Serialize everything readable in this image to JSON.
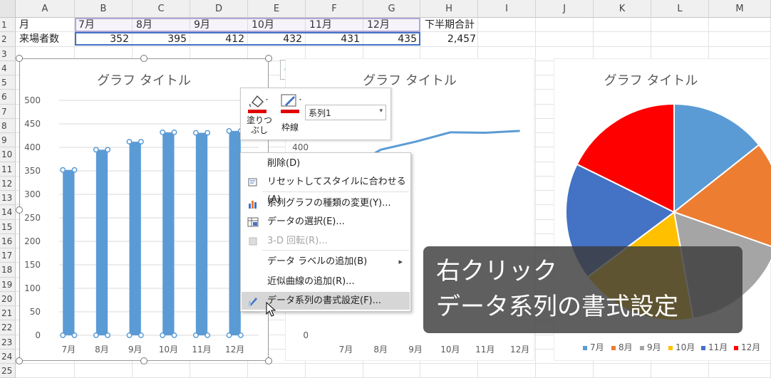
{
  "columns": [
    "A",
    "B",
    "C",
    "D",
    "E",
    "F",
    "G",
    "H",
    "I",
    "J",
    "K",
    "L",
    "M"
  ],
  "rows": [
    "1",
    "2",
    "3",
    "4",
    "5",
    "6",
    "7",
    "8",
    "9",
    "10",
    "11",
    "12",
    "13",
    "14",
    "15",
    "16",
    "17",
    "18",
    "19",
    "20",
    "21",
    "22",
    "23",
    "24",
    "25"
  ],
  "table": {
    "row1": {
      "a": "月",
      "months": [
        "7月",
        "8月",
        "9月",
        "10月",
        "11月",
        "12月"
      ],
      "h": "下半期合計"
    },
    "row2": {
      "a": "来場者数",
      "values": [
        "352",
        "395",
        "412",
        "432",
        "431",
        "435"
      ],
      "h": "2,457"
    }
  },
  "chart_data": [
    {
      "type": "bar",
      "title": "グラフ タイトル",
      "categories": [
        "7月",
        "8月",
        "9月",
        "10月",
        "11月",
        "12月"
      ],
      "values": [
        352,
        395,
        412,
        432,
        431,
        435
      ],
      "ylim": [
        0,
        500
      ],
      "yticks": [
        "0",
        "50",
        "100",
        "150",
        "200",
        "250",
        "300",
        "350",
        "400",
        "450",
        "500"
      ],
      "color": "#5b9bd5"
    },
    {
      "type": "line",
      "title": "グラフ タイトル",
      "categories": [
        "7月",
        "8月",
        "9月",
        "10月",
        "11月",
        "12月"
      ],
      "values": [
        352,
        395,
        412,
        432,
        431,
        435
      ],
      "ylim": [
        0,
        500
      ],
      "yticks": [
        "0",
        "400"
      ],
      "color": "#5b9bd5"
    },
    {
      "type": "pie",
      "title": "グラフ タイトル",
      "categories": [
        "7月",
        "8月",
        "9月",
        "10月",
        "11月",
        "12月"
      ],
      "values": [
        352,
        395,
        412,
        432,
        431,
        435
      ],
      "colors": [
        "#5b9bd5",
        "#ed7d31",
        "#a5a5a5",
        "#ffc000",
        "#4472c4",
        "#ff0000"
      ],
      "legend": "bottom"
    }
  ],
  "mini_toolbar": {
    "fill_label": "塗りつ\nぶし",
    "outline_label": "枠線",
    "series_select": "系列1"
  },
  "context_menu": [
    {
      "label": "削除(D)",
      "disabled": false
    },
    {
      "label": "リセットしてスタイルに合わせる(A)",
      "disabled": false
    },
    {
      "label": "系列グラフの種類の変更(Y)...",
      "disabled": false
    },
    {
      "label": "データの選択(E)...",
      "disabled": false
    },
    {
      "label": "3-D 回転(R)...",
      "disabled": true
    },
    {
      "label": "データ ラベルの追加(B)",
      "disabled": false,
      "submenu": true
    },
    {
      "label": "近似曲線の追加(R)...",
      "disabled": false
    },
    {
      "label": "データ系列の書式設定(F)...",
      "disabled": false,
      "highlight": true
    }
  ],
  "caption": {
    "line1": "右クリック",
    "line2": "データ系列の書式設定"
  },
  "plus_button": "+"
}
